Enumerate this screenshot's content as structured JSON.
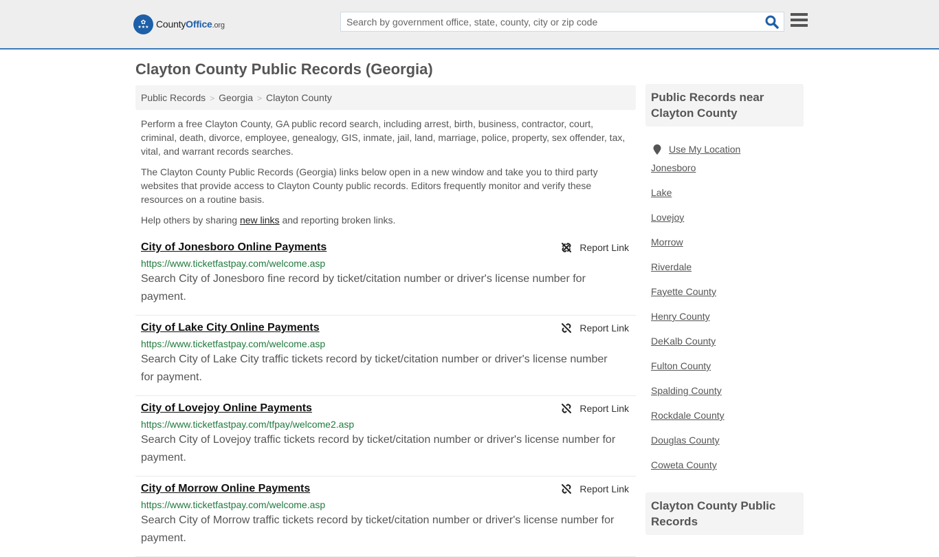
{
  "header": {
    "logo": {
      "name_part1": "County",
      "name_part2": "Office",
      "tld": ".org"
    },
    "search": {
      "placeholder": "Search by government office, state, county, city or zip code",
      "value": ""
    },
    "icons": {
      "search": "search-icon",
      "menu": "hamburger-menu-icon"
    },
    "accent_color": "#1d5fa8"
  },
  "page": {
    "title": "Clayton County Public Records (Georgia)"
  },
  "breadcrumb": [
    {
      "label": "Public Records"
    },
    {
      "label": "Georgia"
    },
    {
      "label": "Clayton County"
    }
  ],
  "intro": {
    "p1": "Perform a free Clayton County, GA public record search, including arrest, birth, business, contractor, court, criminal, death, divorce, employee, genealogy, GIS, inmate, jail, land, marriage, police, property, sex offender, tax, vital, and warrant records searches.",
    "p2": "The Clayton County Public Records (Georgia) links below open in a new window and take you to third party websites that provide access to Clayton County public records. Editors frequently monitor and verify these resources on a routine basis.",
    "p3_before": "Help others by sharing ",
    "p3_link": "new links",
    "p3_after": " and reporting broken links."
  },
  "records": [
    {
      "title": "City of Jonesboro Online Payments",
      "url": "https://www.ticketfastpay.com/welcome.asp",
      "description": "Search City of Jonesboro fine record by ticket/citation number or driver's license number for payment.",
      "report_label": "Report Link"
    },
    {
      "title": "City of Lake City Online Payments",
      "url": "https://www.ticketfastpay.com/welcome.asp",
      "description": "Search City of Lake City traffic tickets record by ticket/citation number or driver's license number for payment.",
      "report_label": "Report Link"
    },
    {
      "title": "City of Lovejoy Online Payments",
      "url": "https://www.ticketfastpay.com/tfpay/welcome2.asp",
      "description": "Search City of Lovejoy traffic tickets record by ticket/citation number or driver's license number for payment.",
      "report_label": "Report Link"
    },
    {
      "title": "City of Morrow Online Payments",
      "url": "https://www.ticketfastpay.com/welcome.asp",
      "description": "Search City of Morrow traffic tickets record by ticket/citation number or driver's license number for payment.",
      "report_label": "Report Link"
    }
  ],
  "sidebar": {
    "heading": "Public Records near Clayton County",
    "use_location": "Use My Location",
    "items": [
      {
        "label": "Jonesboro"
      },
      {
        "label": "Lake"
      },
      {
        "label": "Lovejoy"
      },
      {
        "label": "Morrow"
      },
      {
        "label": "Riverdale"
      },
      {
        "label": "Fayette County"
      },
      {
        "label": "Henry County"
      },
      {
        "label": "DeKalb County"
      },
      {
        "label": "Fulton County"
      },
      {
        "label": "Spalding County"
      },
      {
        "label": "Rockdale County"
      },
      {
        "label": "Douglas County"
      },
      {
        "label": "Coweta County"
      }
    ],
    "heading2": "Clayton County Public Records"
  }
}
